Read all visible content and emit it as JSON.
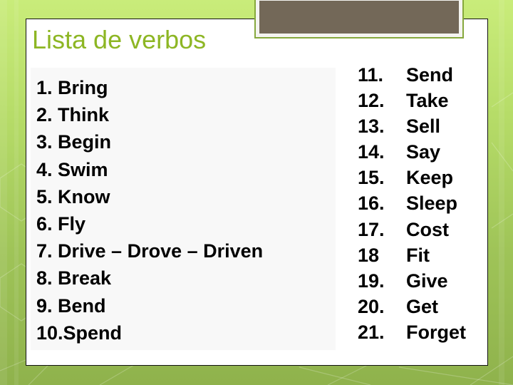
{
  "slide": {
    "title": "Lista de verbos",
    "colors": {
      "title": "#8db624",
      "accent_bar": "#736858",
      "background_top": "#c9ec7a",
      "background_bottom": "#8fb24c",
      "card": "#ffffff"
    },
    "left_list": [
      "1. Bring",
      "2. Think",
      "3. Begin",
      "4. Swim",
      "5. Know",
      "6. Fly",
      "7. Drive – Drove – Driven",
      "8. Break",
      "9. Bend",
      "10.Spend"
    ],
    "right_list": [
      {
        "num": "11.",
        "verb": "Send"
      },
      {
        "num": "12.",
        "verb": "Take"
      },
      {
        "num": "13.",
        "verb": "Sell"
      },
      {
        "num": "14.",
        "verb": "Say"
      },
      {
        "num": "15.",
        "verb": "Keep"
      },
      {
        "num": "16.",
        "verb": "Sleep"
      },
      {
        "num": "17.",
        "verb": "Cost"
      },
      {
        "num": "18",
        "verb": "Fit"
      },
      {
        "num": "19.",
        "verb": "Give"
      },
      {
        "num": "20.",
        "verb": "Get"
      },
      {
        "num": "21.",
        "verb": "Forget"
      }
    ]
  }
}
